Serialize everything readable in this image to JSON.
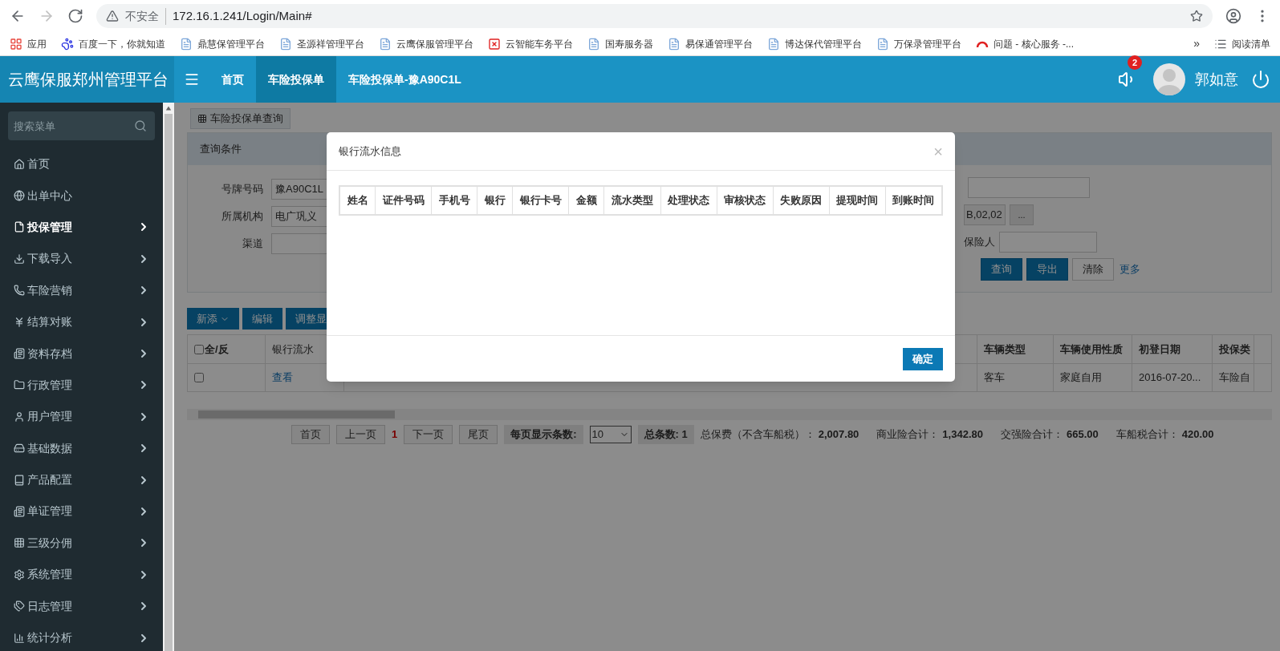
{
  "browser": {
    "security": "不安全",
    "url": "172.16.1.241/Login/Main#",
    "bookmarks": [
      {
        "label": "应用",
        "kind": "apps"
      },
      {
        "label": "百度一下，你就知道",
        "kind": "paw"
      },
      {
        "label": "鼎慧保管理平台",
        "kind": "page"
      },
      {
        "label": "圣源祥管理平台",
        "kind": "page"
      },
      {
        "label": "云鹰保服管理平台",
        "kind": "page"
      },
      {
        "label": "云智能车务平台",
        "kind": "redx"
      },
      {
        "label": "国寿服务器",
        "kind": "page"
      },
      {
        "label": "易保通管理平台",
        "kind": "page"
      },
      {
        "label": "博达保代管理平台",
        "kind": "page"
      },
      {
        "label": "万保录管理平台",
        "kind": "page"
      },
      {
        "label": "问题 - 核心服务 -...",
        "kind": "arc"
      }
    ],
    "more": "»",
    "reading_list": "阅读清单"
  },
  "header": {
    "title": "云鹰保服郑州管理平台",
    "tabs": [
      {
        "label": "首页",
        "selected": false
      },
      {
        "label": "车险投保单",
        "selected": true
      },
      {
        "label": "车险投保单-豫A90C1L",
        "selected": false
      }
    ],
    "notification_count": "2",
    "user": "郭如意"
  },
  "sidebar": {
    "search_placeholder": "搜索菜单",
    "items": [
      {
        "label": "首页",
        "selected": false,
        "expandable": false
      },
      {
        "label": "出单中心",
        "selected": false,
        "expandable": false
      },
      {
        "label": "投保管理",
        "selected": true,
        "expandable": true
      },
      {
        "label": "下载导入",
        "selected": false,
        "expandable": true
      },
      {
        "label": "车险营销",
        "selected": false,
        "expandable": true
      },
      {
        "label": "结算对账",
        "selected": false,
        "expandable": true
      },
      {
        "label": "资料存档",
        "selected": false,
        "expandable": true
      },
      {
        "label": "行政管理",
        "selected": false,
        "expandable": true
      },
      {
        "label": "用户管理",
        "selected": false,
        "expandable": true
      },
      {
        "label": "基础数据",
        "selected": false,
        "expandable": true
      },
      {
        "label": "产品配置",
        "selected": false,
        "expandable": true
      },
      {
        "label": "单证管理",
        "selected": false,
        "expandable": true
      },
      {
        "label": "三级分佣",
        "selected": false,
        "expandable": true
      },
      {
        "label": "系统管理",
        "selected": false,
        "expandable": true
      },
      {
        "label": "日志管理",
        "selected": false,
        "expandable": true
      },
      {
        "label": "统计分析",
        "selected": false,
        "expandable": true
      }
    ]
  },
  "main": {
    "query_tab": "车险投保单查询",
    "panel_title": "查询条件",
    "form_left": [
      {
        "label": "号牌号码",
        "value": "豫A90C1L"
      },
      {
        "label": "所属机构",
        "value": "电广巩义"
      },
      {
        "label": "渠道"
      }
    ],
    "org_code": "B,02,02",
    "picker_button": "...",
    "insured_label": "保险人",
    "buttons": [
      "查询",
      "导出",
      "清除"
    ],
    "more_link": "更多",
    "toolbar": [
      {
        "label": "新添",
        "dropdown": true
      },
      {
        "label": "编辑",
        "dropdown": false
      },
      {
        "label": "调整显",
        "dropdown": false
      }
    ],
    "table": {
      "select_all": {
        "label": "全/反",
        "checked": false
      },
      "left_columns": [
        "银行流水"
      ],
      "right_columns": [
        "车辆类型",
        "车辆使用性质",
        "初登日期",
        "投保类"
      ],
      "rows": [
        {
          "checked": false,
          "link": "查看",
          "right_cells": [
            "客车",
            "家庭自用",
            "2016-07-20...",
            "车险自"
          ]
        }
      ]
    },
    "pager": {
      "buttons": [
        "首页",
        "上一页"
      ],
      "current": "1",
      "buttons_after": [
        "下一页",
        "尾页"
      ],
      "page_size_label": "每页显示条数:",
      "page_size": "10",
      "total": "总条数: 1",
      "summary": [
        {
          "label": "总保费（不含车船税）：",
          "value": "2,007.80"
        },
        {
          "label": "商业险合计：",
          "value": "1,342.80"
        },
        {
          "label": "交强险合计：",
          "value": "665.00"
        },
        {
          "label": "车船税合计：",
          "value": "420.00"
        }
      ]
    }
  },
  "dialog": {
    "title": "银行流水信息",
    "close": "×",
    "columns": [
      "姓名",
      "证件号码",
      "手机号",
      "银行",
      "银行卡号",
      "金额",
      "流水类型",
      "处理状态",
      "审核状态",
      "失败原因",
      "提现时间",
      "到账时间"
    ],
    "ok": "确定"
  }
}
